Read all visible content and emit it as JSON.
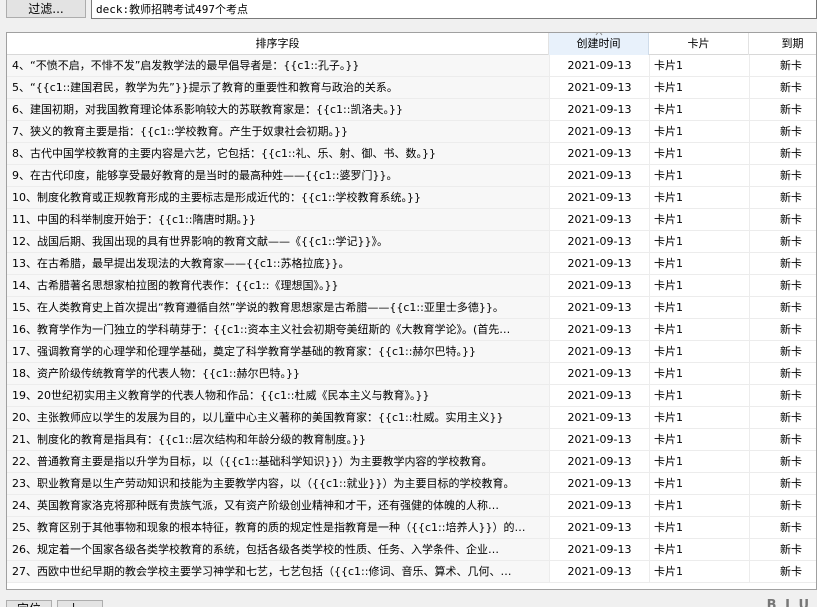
{
  "toolbar": {
    "filter_label": "过滤...",
    "search_value": "deck:教师招聘考试497个考点"
  },
  "table": {
    "columns": [
      "排序字段",
      "创建时间",
      "卡片",
      "到期"
    ],
    "rows": [
      {
        "sort": "4、“不愤不启，不悱不发”启发教学法的最早倡导者是：{{c1::孔子。}}",
        "created": "2021-09-13",
        "card": "卡片1",
        "due": "新卡"
      },
      {
        "sort": "5、“{{c1::建国君民，教学为先”}}提示了教育的重要性和教育与政治的关系。",
        "created": "2021-09-13",
        "card": "卡片1",
        "due": "新卡"
      },
      {
        "sort": "6、建国初期，对我国教育理论体系影响较大的苏联教育家是：{{c1::凯洛夫。}}",
        "created": "2021-09-13",
        "card": "卡片1",
        "due": "新卡"
      },
      {
        "sort": "7、狭义的教育主要是指：{{c1::学校教育。产生于奴隶社会初期。}}",
        "created": "2021-09-13",
        "card": "卡片1",
        "due": "新卡"
      },
      {
        "sort": "8、古代中国学校教育的主要内容是六艺，它包括：{{c1::礼、乐、射、御、书、数。}}",
        "created": "2021-09-13",
        "card": "卡片1",
        "due": "新卡"
      },
      {
        "sort": "9、在古代印度，能够享受最好教育的是当时的最高种姓——{{c1::婆罗门}}。",
        "created": "2021-09-13",
        "card": "卡片1",
        "due": "新卡"
      },
      {
        "sort": "10、制度化教育或正规教育形成的主要标志是形成近代的：{{c1::学校教育系统。}}",
        "created": "2021-09-13",
        "card": "卡片1",
        "due": "新卡"
      },
      {
        "sort": "11、中国的科举制度开始于：{{c1::隋唐时期。}}",
        "created": "2021-09-13",
        "card": "卡片1",
        "due": "新卡"
      },
      {
        "sort": "12、战国后期、我国出现的具有世界影响的教育文献——《{{c1::学记}}》。",
        "created": "2021-09-13",
        "card": "卡片1",
        "due": "新卡"
      },
      {
        "sort": "13、在古希腊，最早提出发现法的大教育家——{{c1::苏格拉底}}。",
        "created": "2021-09-13",
        "card": "卡片1",
        "due": "新卡"
      },
      {
        "sort": "14、古希腊著名思想家柏拉图的教育代表作：{{c1::《理想国》。}}",
        "created": "2021-09-13",
        "card": "卡片1",
        "due": "新卡"
      },
      {
        "sort": "15、在人类教育史上首次提出“教育遵循自然”学说的教育思想家是古希腊——{{c1::亚里士多德}}。",
        "created": "2021-09-13",
        "card": "卡片1",
        "due": "新卡"
      },
      {
        "sort": "16、教育学作为一门独立的学科萌芽于：{{c1::资本主义社会初期夸美纽斯的《大教育学论》。(首先…",
        "created": "2021-09-13",
        "card": "卡片1",
        "due": "新卡"
      },
      {
        "sort": "17、强调教育学的心理学和伦理学基础，奠定了科学教育学基础的教育家：{{c1::赫尔巴特。}}",
        "created": "2021-09-13",
        "card": "卡片1",
        "due": "新卡"
      },
      {
        "sort": "18、资产阶级传统教育学的代表人物：{{c1::赫尔巴特。}}",
        "created": "2021-09-13",
        "card": "卡片1",
        "due": "新卡"
      },
      {
        "sort": "19、20世纪初实用主义教育学的代表人物和作品：{{c1::杜威《民本主义与教育》。}}",
        "created": "2021-09-13",
        "card": "卡片1",
        "due": "新卡"
      },
      {
        "sort": "20、主张教师应以学生的发展为目的，以儿童中心主义著称的美国教育家：{{c1::杜威。实用主义}}",
        "created": "2021-09-13",
        "card": "卡片1",
        "due": "新卡"
      },
      {
        "sort": "21、制度化的教育是指具有：{{c1::层次结构和年龄分级的教育制度。}}",
        "created": "2021-09-13",
        "card": "卡片1",
        "due": "新卡"
      },
      {
        "sort": "22、普通教育主要是指以升学为目标，以（{{c1::基础科学知识}}）为主要教学内容的学校教育。",
        "created": "2021-09-13",
        "card": "卡片1",
        "due": "新卡"
      },
      {
        "sort": "23、职业教育是以生产劳动知识和技能为主要教学内容，以（{{c1::就业}}）为主要目标的学校教育。",
        "created": "2021-09-13",
        "card": "卡片1",
        "due": "新卡"
      },
      {
        "sort": "24、英国教育家洛克将那种既有贵族气派，又有资产阶级创业精神和才干，还有强健的体魄的人称…",
        "created": "2021-09-13",
        "card": "卡片1",
        "due": "新卡"
      },
      {
        "sort": "25、教育区别于其他事物和现象的根本特征，教育的质的规定性是指教育是一种（{{c1::培养人}}）的…",
        "created": "2021-09-13",
        "card": "卡片1",
        "due": "新卡"
      },
      {
        "sort": "26、规定着一个国家各级各类学校教育的系统，包括各级各类学校的性质、任务、入学条件、企业…",
        "created": "2021-09-13",
        "card": "卡片1",
        "due": "新卡"
      },
      {
        "sort": "27、西欧中世纪早期的教会学校主要学习神学和七艺，七艺包括（{{c1::修词、音乐、算术、几何、…",
        "created": "2021-09-13",
        "card": "卡片1",
        "due": "新卡"
      }
    ]
  },
  "footer": {
    "button1": "定位",
    "button2": "上一"
  }
}
